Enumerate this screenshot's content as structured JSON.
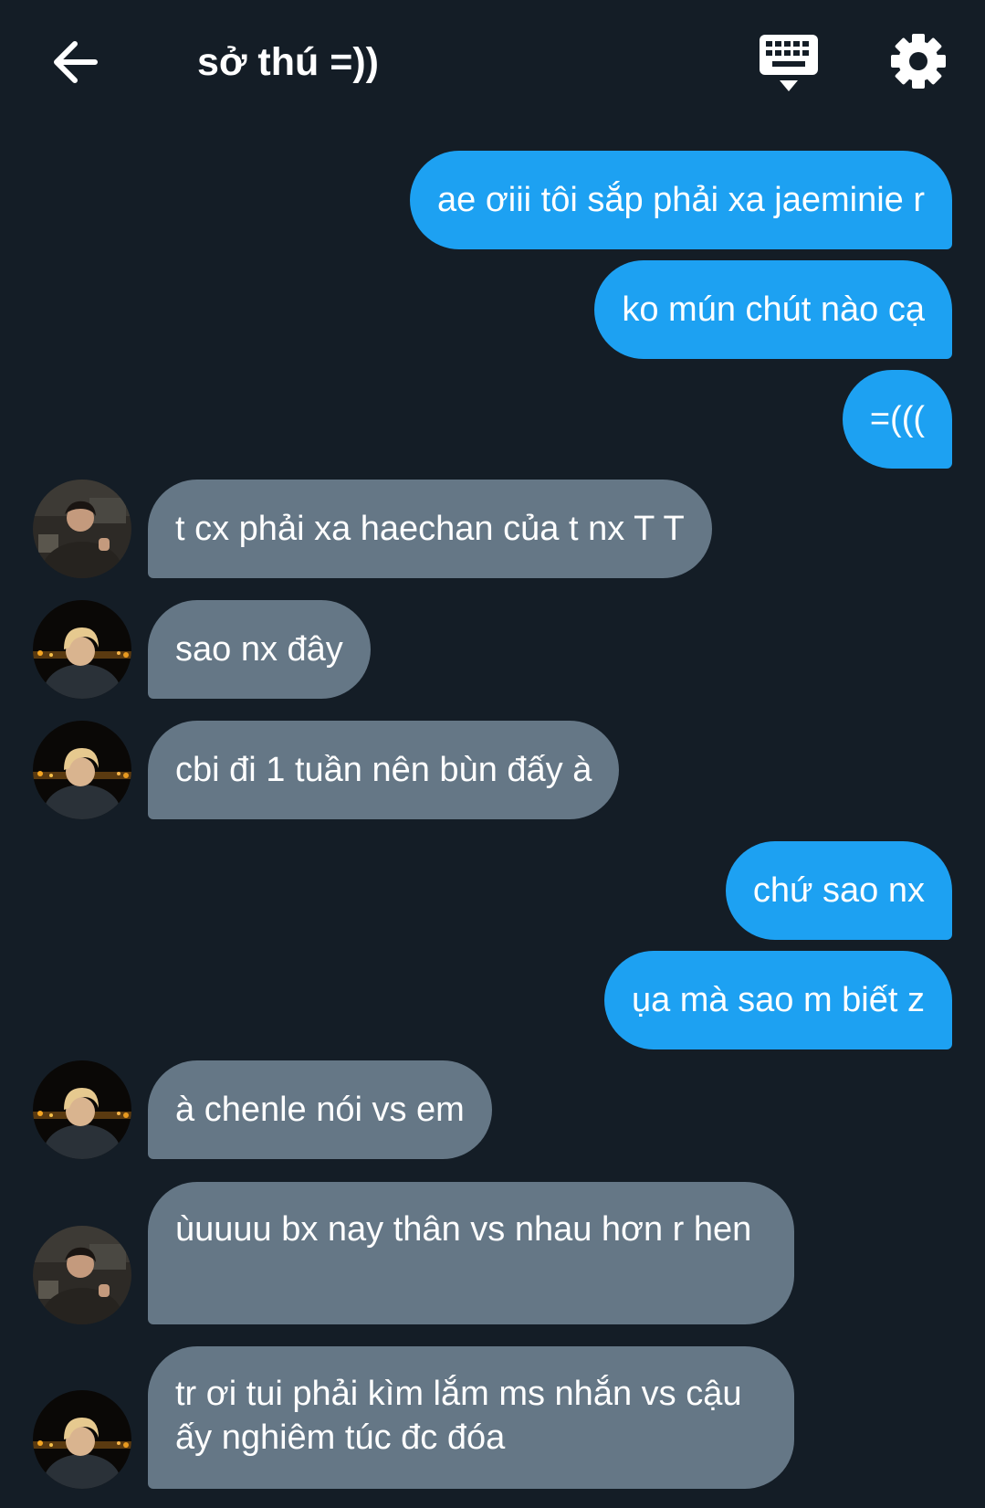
{
  "header": {
    "title": "sở thú =))",
    "icons": {
      "back": "arrow-left-icon",
      "keyboard": "keyboard-icon",
      "settings": "gear-icon"
    }
  },
  "colors": {
    "background": "#141d26",
    "outgoing_bubble": "#1da1f2",
    "incoming_bubble": "#657786",
    "text": "#ffffff"
  },
  "messages": [
    {
      "direction": "out",
      "text": "ae ơiii tôi sắp phải xa jaeminie r"
    },
    {
      "direction": "out",
      "text": "ko mún chút nào cạ"
    },
    {
      "direction": "out",
      "text": "=((("
    },
    {
      "direction": "in",
      "avatar": "member-dark-hair",
      "text": "t cx phải xa haechan của t nx T T"
    },
    {
      "direction": "in",
      "avatar": "member-blonde-hair",
      "text": "sao nx đây"
    },
    {
      "direction": "in",
      "avatar": "member-blonde-hair",
      "text": "cbi đi 1 tuần nên bùn đấy à"
    },
    {
      "direction": "out",
      "text": "chứ sao nx"
    },
    {
      "direction": "out",
      "text": "ụa mà sao m biết z"
    },
    {
      "direction": "in",
      "avatar": "member-blonde-hair",
      "text": "à chenle nói vs em"
    },
    {
      "direction": "in",
      "avatar": "member-dark-hair",
      "text": "ùuuuu bx nay thân vs nhau hơn r hen"
    },
    {
      "direction": "in",
      "avatar": "member-blonde-hair",
      "text": "tr ơi tui phải kìm lắm ms nhắn vs cậu ấy nghiêm túc đc đóa"
    }
  ]
}
